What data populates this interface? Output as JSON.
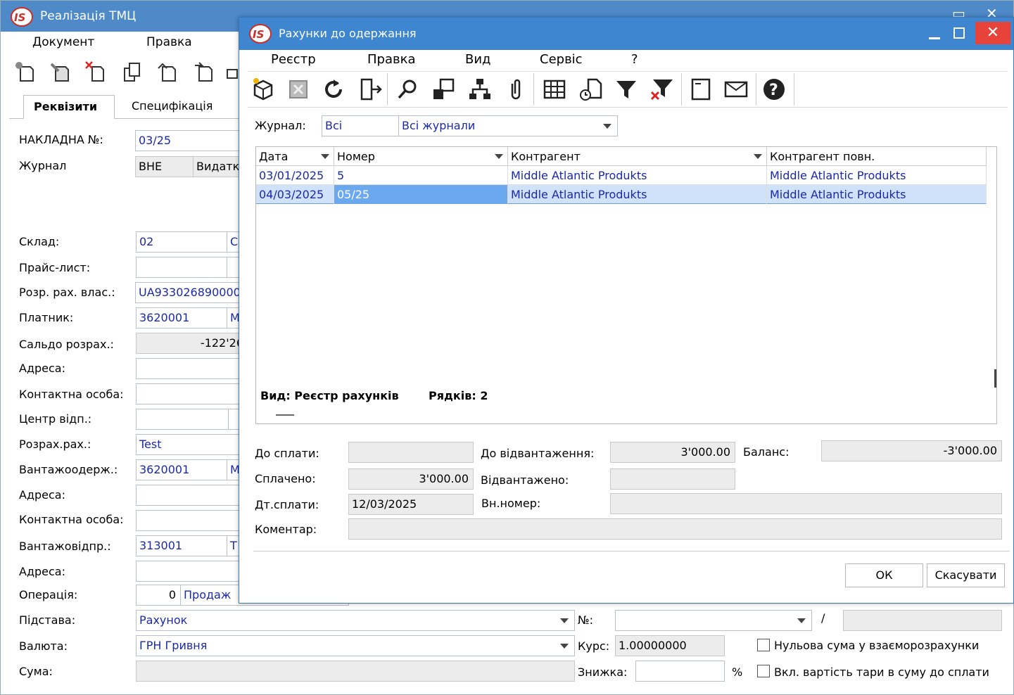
{
  "bg": {
    "title": "Реалізація ТМЦ",
    "menu": [
      "Документ",
      "Правка"
    ],
    "tabs": [
      "Реквізити",
      "Специфікація"
    ],
    "labels": {
      "invoice_no": "НАКЛАДНА №:",
      "journal": "Журнал",
      "warehouse": "Склад:",
      "price_list": "Прайс-лист:",
      "own_account": "Розр. рах. влас.:",
      "payer": "Платник:",
      "balance": "Сальдо розрах.:",
      "address1": "Адреса:",
      "contact1": "Контактна особа:",
      "resp_center": "Центр відп.:",
      "account": "Розрах.рах.:",
      "consignee": "Вантажоодерж.:",
      "address2": "Адреса:",
      "contact2": "Контактна особа:",
      "shipper": "Вантажовідпр.:",
      "address3": "Адреса:",
      "operation": "Операція:",
      "basis": "Підстава:",
      "currency": "Валюта:",
      "sum": "Сума:",
      "no": "№:",
      "rate": "Курс:",
      "discount": "Знижка:",
      "percent": "%",
      "slash": "/",
      "zero_sum": "Нульова сума у взаєморозрахунки",
      "tare": "Вкл. вартість тари в суму до сплати"
    },
    "values": {
      "invoice_no": "03/25",
      "journal_code": "ВНЕ",
      "journal_name": "Видатк",
      "warehouse": "02",
      "warehouse_name": "С",
      "own_account": "UA933026890000",
      "payer": "3620001",
      "payer_name": "M",
      "balance": "-122'26",
      "account": "Test",
      "consignee": "3620001",
      "consignee_name": "M",
      "shipper": "313001",
      "shipper_name": "T",
      "operation_code": "0",
      "operation_name": "Продаж",
      "basis": "Рахунок",
      "currency": "ГРН Гривня",
      "rate": "1.00000000"
    }
  },
  "dialog": {
    "title": "Рахунки до одержання",
    "close_glyph": "✕",
    "menu": [
      "Реєстр",
      "Правка",
      "Вид",
      "Сервіс",
      "?"
    ],
    "journal_label": "Журнал:",
    "journal_code": "Всі",
    "journal_name": "Всі журнали",
    "columns": [
      "Дата",
      "Номер",
      "Контрагент",
      "Контрагент повн."
    ],
    "rows": [
      {
        "date": "03/01/2025",
        "number": "5",
        "contractor": "Middle Atlantic Produkts",
        "contractor_full": "Middle Atlantic Produkts"
      },
      {
        "date": "04/03/2025",
        "number": "05/25",
        "contractor": "Middle Atlantic Produkts",
        "contractor_full": "Middle Atlantic Produkts"
      }
    ],
    "footer_view": "Вид: Реєстр рахунків",
    "footer_rows": "Рядків: 2",
    "fields": {
      "to_pay_label": "До сплати:",
      "to_pay": "",
      "to_ship_label": "До відвантаження:",
      "to_ship": "3'000.00",
      "balance_label": "Баланс:",
      "balance": "-3'000.00",
      "paid_label": "Сплачено:",
      "paid": "3'000.00",
      "shipped_label": "Відвантажено:",
      "shipped": "",
      "pay_date_label": "Дт.сплати:",
      "pay_date": "12/03/2025",
      "int_no_label": "Вн.номер:",
      "int_no": "",
      "comment_label": "Коментар:",
      "comment": ""
    },
    "ok_label": "ОК",
    "cancel_label": "Скасувати"
  }
}
